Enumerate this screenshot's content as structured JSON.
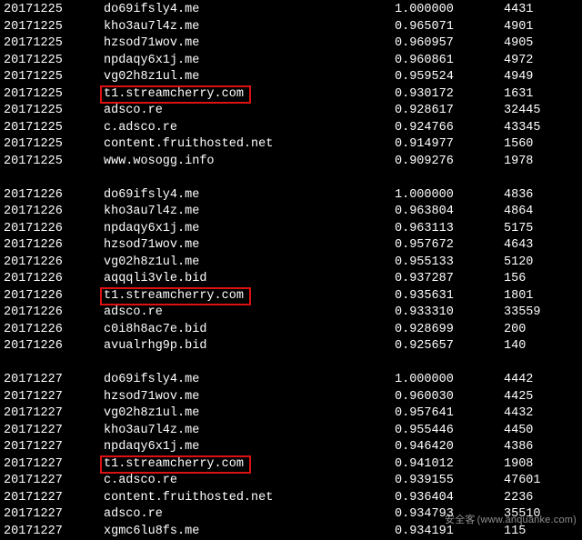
{
  "watermark": {
    "cn": "安全客",
    "url": "(www.anquanke.com)"
  },
  "highlight_hosts": [
    "t1.streamcherry.com"
  ],
  "groups": [
    {
      "rows": [
        {
          "date": "20171225",
          "host": "do69ifsly4.me",
          "value": "1.000000",
          "count": "4431"
        },
        {
          "date": "20171225",
          "host": "kho3au7l4z.me",
          "value": "0.965071",
          "count": "4901"
        },
        {
          "date": "20171225",
          "host": "hzsod71wov.me",
          "value": "0.960957",
          "count": "4905"
        },
        {
          "date": "20171225",
          "host": "npdaqy6x1j.me",
          "value": "0.960861",
          "count": "4972"
        },
        {
          "date": "20171225",
          "host": "vg02h8z1ul.me",
          "value": "0.959524",
          "count": "4949"
        },
        {
          "date": "20171225",
          "host": "t1.streamcherry.com",
          "value": "0.930172",
          "count": "1631",
          "hl": true
        },
        {
          "date": "20171225",
          "host": "adsco.re",
          "value": "0.928617",
          "count": "32445"
        },
        {
          "date": "20171225",
          "host": "c.adsco.re",
          "value": "0.924766",
          "count": "43345"
        },
        {
          "date": "20171225",
          "host": "content.fruithosted.net",
          "value": "0.914977",
          "count": "1560"
        },
        {
          "date": "20171225",
          "host": "www.wosogg.info",
          "value": "0.909276",
          "count": "1978"
        }
      ]
    },
    {
      "rows": [
        {
          "date": "20171226",
          "host": "do69ifsly4.me",
          "value": "1.000000",
          "count": "4836"
        },
        {
          "date": "20171226",
          "host": "kho3au7l4z.me",
          "value": "0.963804",
          "count": "4864"
        },
        {
          "date": "20171226",
          "host": "npdaqy6x1j.me",
          "value": "0.963113",
          "count": "5175"
        },
        {
          "date": "20171226",
          "host": "hzsod71wov.me",
          "value": "0.957672",
          "count": "4643"
        },
        {
          "date": "20171226",
          "host": "vg02h8z1ul.me",
          "value": "0.955133",
          "count": "5120"
        },
        {
          "date": "20171226",
          "host": "aqqqli3vle.bid",
          "value": "0.937287",
          "count": "156"
        },
        {
          "date": "20171226",
          "host": "t1.streamcherry.com",
          "value": "0.935631",
          "count": "1801",
          "hl": true
        },
        {
          "date": "20171226",
          "host": "adsco.re",
          "value": "0.933310",
          "count": "33559"
        },
        {
          "date": "20171226",
          "host": "c0i8h8ac7e.bid",
          "value": "0.928699",
          "count": "200"
        },
        {
          "date": "20171226",
          "host": "avualrhg9p.bid",
          "value": "0.925657",
          "count": "140"
        }
      ]
    },
    {
      "rows": [
        {
          "date": "20171227",
          "host": "do69ifsly4.me",
          "value": "1.000000",
          "count": "4442"
        },
        {
          "date": "20171227",
          "host": "hzsod71wov.me",
          "value": "0.960030",
          "count": "4425"
        },
        {
          "date": "20171227",
          "host": "vg02h8z1ul.me",
          "value": "0.957641",
          "count": "4432"
        },
        {
          "date": "20171227",
          "host": "kho3au7l4z.me",
          "value": "0.955446",
          "count": "4450"
        },
        {
          "date": "20171227",
          "host": "npdaqy6x1j.me",
          "value": "0.946420",
          "count": "4386"
        },
        {
          "date": "20171227",
          "host": "t1.streamcherry.com",
          "value": "0.941012",
          "count": "1908",
          "hl": true
        },
        {
          "date": "20171227",
          "host": "c.adsco.re",
          "value": "0.939155",
          "count": "47601"
        },
        {
          "date": "20171227",
          "host": "content.fruithosted.net",
          "value": "0.936404",
          "count": "2236"
        },
        {
          "date": "20171227",
          "host": "adsco.re",
          "value": "0.934793",
          "count": "35510"
        },
        {
          "date": "20171227",
          "host": "xgmc6lu8fs.me",
          "value": "0.934191",
          "count": "115"
        }
      ]
    }
  ]
}
